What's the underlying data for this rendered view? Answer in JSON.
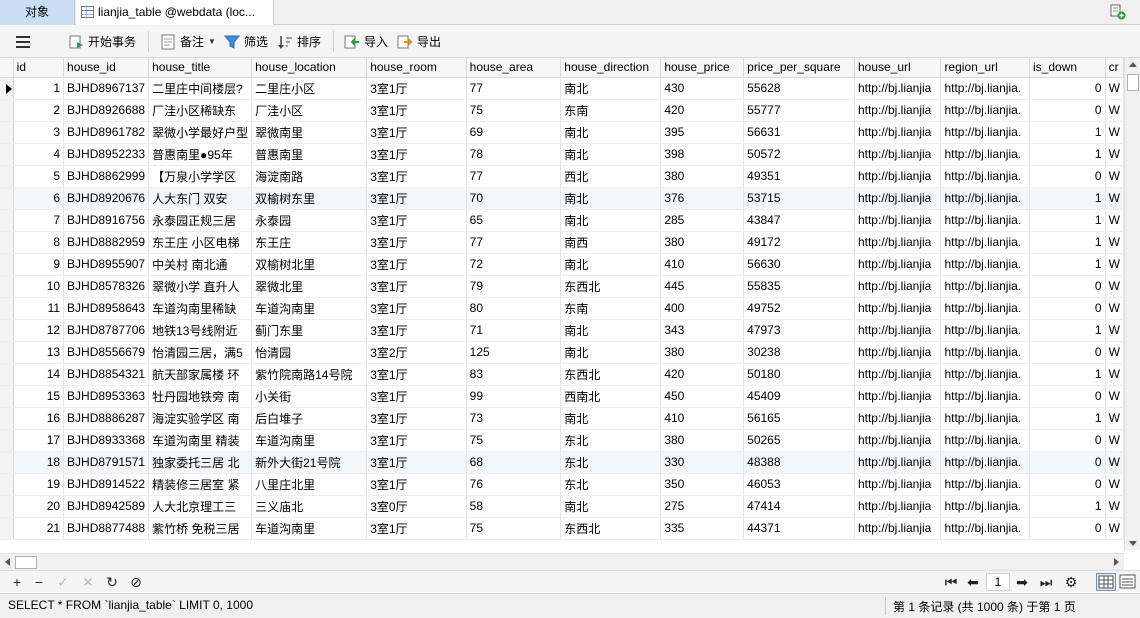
{
  "tabs": {
    "objects_label": "对象",
    "table_tab_label": "lianjia_table @webdata (loc..."
  },
  "toolbar": {
    "begin_transaction": "开始事务",
    "memo": "备注",
    "filter": "筛选",
    "sort": "排序",
    "import": "导入",
    "export": "导出"
  },
  "grid": {
    "columns": [
      "id",
      "house_id",
      "house_title",
      "house_location",
      "house_room",
      "house_area",
      "house_direction",
      "house_price",
      "price_per_square",
      "house_url",
      "region_url",
      "is_down",
      "cr"
    ],
    "rows": [
      [
        "1",
        "BJHD8967137",
        "二里庄中间楼层?",
        "二里庄小区",
        "3室1厅",
        "77",
        "南北",
        "430",
        "55628",
        "http://bj.lianjia",
        "http://bj.lianjia.",
        "0",
        "W"
      ],
      [
        "2",
        "BJHD8926688",
        "厂洼小区稀缺东",
        "厂洼小区",
        "3室1厅",
        "75",
        "东南",
        "420",
        "55777",
        "http://bj.lianjia",
        "http://bj.lianjia.",
        "0",
        "W"
      ],
      [
        "3",
        "BJHD8961782",
        "翠微小学最好户型",
        "翠微南里",
        "3室1厅",
        "69",
        "南北",
        "395",
        "56631",
        "http://bj.lianjia",
        "http://bj.lianjia.",
        "1",
        "W"
      ],
      [
        "4",
        "BJHD8952233",
        "普惠南里●95年",
        "普惠南里",
        "3室1厅",
        "78",
        "南北",
        "398",
        "50572",
        "http://bj.lianjia",
        "http://bj.lianjia.",
        "1",
        "W"
      ],
      [
        "5",
        "BJHD8862999",
        "【万泉小学学区",
        "海淀南路",
        "3室1厅",
        "77",
        "西北",
        "380",
        "49351",
        "http://bj.lianjia",
        "http://bj.lianjia.",
        "0",
        "W"
      ],
      [
        "6",
        "BJHD8920676",
        "人大东门  双安",
        "双榆树东里",
        "3室1厅",
        "70",
        "南北",
        "376",
        "53715",
        "http://bj.lianjia",
        "http://bj.lianjia.",
        "1",
        "W"
      ],
      [
        "7",
        "BJHD8916756",
        "永泰园正规三居",
        "永泰园",
        "3室1厅",
        "65",
        "南北",
        "285",
        "43847",
        "http://bj.lianjia",
        "http://bj.lianjia.",
        "1",
        "W"
      ],
      [
        "8",
        "BJHD8882959",
        "东王庄 小区电梯",
        "东王庄",
        "3室1厅",
        "77",
        "南西",
        "380",
        "49172",
        "http://bj.lianjia",
        "http://bj.lianjia.",
        "1",
        "W"
      ],
      [
        "9",
        "BJHD8955907",
        "中关村  南北通",
        "双榆树北里",
        "3室1厅",
        "72",
        "南北",
        "410",
        "56630",
        "http://bj.lianjia",
        "http://bj.lianjia.",
        "1",
        "W"
      ],
      [
        "10",
        "BJHD8578326",
        "翠微小学 直升人",
        "翠微北里",
        "3室1厅",
        "79",
        "东西北",
        "445",
        "55835",
        "http://bj.lianjia",
        "http://bj.lianjia.",
        "0",
        "W"
      ],
      [
        "11",
        "BJHD8958643",
        "车道沟南里稀缺",
        "车道沟南里",
        "3室1厅",
        "80",
        "东南",
        "400",
        "49752",
        "http://bj.lianjia",
        "http://bj.lianjia.",
        "0",
        "W"
      ],
      [
        "12",
        "BJHD8787706",
        "地铁13号线附近",
        "蓟门东里",
        "3室1厅",
        "71",
        "南北",
        "343",
        "47973",
        "http://bj.lianjia",
        "http://bj.lianjia.",
        "1",
        "W"
      ],
      [
        "13",
        "BJHD8556679",
        "怡清园三居，满5",
        "怡清园",
        "3室2厅",
        "125",
        "南北",
        "380",
        "30238",
        "http://bj.lianjia",
        "http://bj.lianjia.",
        "0",
        "W"
      ],
      [
        "14",
        "BJHD8854321",
        "航天部家属楼 环",
        "紫竹院南路14号院",
        "3室1厅",
        "83",
        "东西北",
        "420",
        "50180",
        "http://bj.lianjia",
        "http://bj.lianjia.",
        "1",
        "W"
      ],
      [
        "15",
        "BJHD8953363",
        "牡丹园地铁旁 南",
        "小关街",
        "3室1厅",
        "99",
        "西南北",
        "450",
        "45409",
        "http://bj.lianjia",
        "http://bj.lianjia.",
        "0",
        "W"
      ],
      [
        "16",
        "BJHD8886287",
        "海淀实验学区 南",
        "后白堆子",
        "3室1厅",
        "73",
        "南北",
        "410",
        "56165",
        "http://bj.lianjia",
        "http://bj.lianjia.",
        "1",
        "W"
      ],
      [
        "17",
        "BJHD8933368",
        "车道沟南里 精装",
        "车道沟南里",
        "3室1厅",
        "75",
        "东北",
        "380",
        "50265",
        "http://bj.lianjia",
        "http://bj.lianjia.",
        "0",
        "W"
      ],
      [
        "18",
        "BJHD8791571",
        "独家委托三居 北",
        "新外大街21号院",
        "3室1厅",
        "68",
        "东北",
        "330",
        "48388",
        "http://bj.lianjia",
        "http://bj.lianjia.",
        "0",
        "W"
      ],
      [
        "19",
        "BJHD8914522",
        "精装修三居室 紧",
        "八里庄北里",
        "3室1厅",
        "76",
        "东北",
        "350",
        "46053",
        "http://bj.lianjia",
        "http://bj.lianjia.",
        "0",
        "W"
      ],
      [
        "20",
        "BJHD8942589",
        "人大北京理工三",
        "三义庙北",
        "3室0厅",
        "58",
        "南北",
        "275",
        "47414",
        "http://bj.lianjia",
        "http://bj.lianjia.",
        "1",
        "W"
      ],
      [
        "21",
        "BJHD8877488",
        "紫竹桥 免税三居",
        "车道沟南里",
        "3室1厅",
        "75",
        "东西北",
        "335",
        "44371",
        "http://bj.lianjia",
        "http://bj.lianjia.",
        "0",
        "W"
      ]
    ]
  },
  "pager": {
    "current_page": "1"
  },
  "status": {
    "sql": "SELECT * FROM `lianjia_table` LIMIT 0, 1000",
    "records": "第 1 条记录 (共 1000 条) 于第 1 页"
  },
  "colors": {
    "tab_active": "#c9def5",
    "alt_row": "#f2f7fc",
    "accent_green": "#2e9b3a"
  }
}
